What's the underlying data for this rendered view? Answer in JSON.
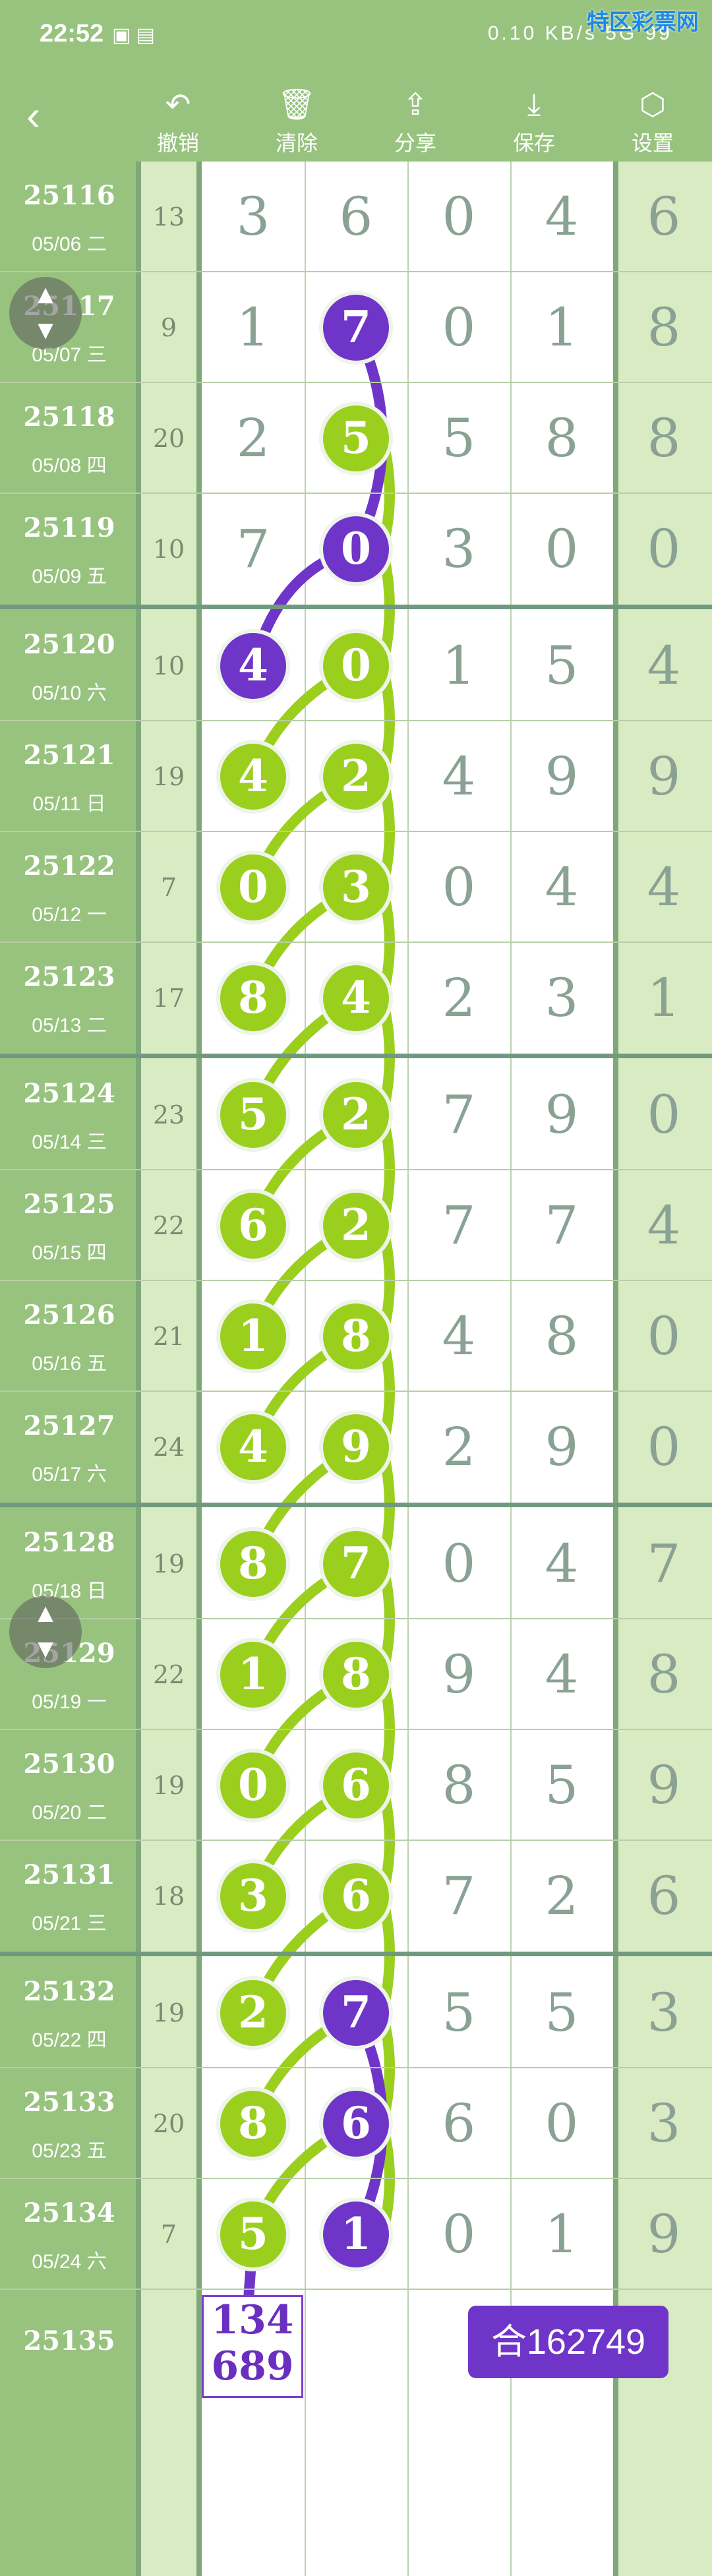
{
  "statusbar": {
    "time": "22:52",
    "right": "0.10 KB/s  5G  99",
    "watermark": "特区彩票网"
  },
  "toolbar": {
    "back_icon": "back-arrow-icon",
    "buttons": [
      {
        "label": "撤销",
        "icon": "undo-icon"
      },
      {
        "label": "清除",
        "icon": "trash-icon"
      },
      {
        "label": "分享",
        "icon": "share-icon"
      },
      {
        "label": "保存",
        "icon": "download-icon"
      },
      {
        "label": "设置",
        "icon": "gear-icon"
      }
    ]
  },
  "colors": {
    "green_ball": "#9bcf1e",
    "purple_ball": "#6f35c8",
    "header": "#97c37f"
  },
  "rows": [
    {
      "issue": "25116",
      "date": "05/06 二",
      "sum": "13",
      "digits": [
        "3",
        "6",
        "0",
        "4"
      ],
      "right": "6",
      "ball1": null,
      "ball2": null
    },
    {
      "issue": "25117",
      "date": "05/07 三",
      "sum": "9",
      "digits": [
        "1",
        "7",
        "0",
        "1"
      ],
      "right": "8",
      "ball1": null,
      "ball2": "p"
    },
    {
      "issue": "25118",
      "date": "05/08 四",
      "sum": "20",
      "digits": [
        "2",
        "5",
        "5",
        "8"
      ],
      "right": "8",
      "ball1": null,
      "ball2": "g"
    },
    {
      "issue": "25119",
      "date": "05/09 五",
      "sum": "10",
      "digits": [
        "7",
        "0",
        "3",
        "0"
      ],
      "right": "0",
      "ball1": null,
      "ball2": "p"
    },
    {
      "issue": "25120",
      "date": "05/10 六",
      "sum": "10",
      "digits": [
        "4",
        "0",
        "1",
        "5"
      ],
      "right": "4",
      "ball1": "p",
      "ball2": "g"
    },
    {
      "issue": "25121",
      "date": "05/11 日",
      "sum": "19",
      "digits": [
        "4",
        "2",
        "4",
        "9"
      ],
      "right": "9",
      "ball1": "g",
      "ball2": "g"
    },
    {
      "issue": "25122",
      "date": "05/12 一",
      "sum": "7",
      "digits": [
        "0",
        "3",
        "0",
        "4"
      ],
      "right": "4",
      "ball1": "g",
      "ball2": "g"
    },
    {
      "issue": "25123",
      "date": "05/13 二",
      "sum": "17",
      "digits": [
        "8",
        "4",
        "2",
        "3"
      ],
      "right": "1",
      "ball1": "g",
      "ball2": "g"
    },
    {
      "issue": "25124",
      "date": "05/14 三",
      "sum": "23",
      "digits": [
        "5",
        "2",
        "7",
        "9"
      ],
      "right": "0",
      "ball1": "g",
      "ball2": "g"
    },
    {
      "issue": "25125",
      "date": "05/15 四",
      "sum": "22",
      "digits": [
        "6",
        "2",
        "7",
        "7"
      ],
      "right": "4",
      "ball1": "g",
      "ball2": "g"
    },
    {
      "issue": "25126",
      "date": "05/16 五",
      "sum": "21",
      "digits": [
        "1",
        "8",
        "4",
        "8"
      ],
      "right": "0",
      "ball1": "g",
      "ball2": "g"
    },
    {
      "issue": "25127",
      "date": "05/17 六",
      "sum": "24",
      "digits": [
        "4",
        "9",
        "2",
        "9"
      ],
      "right": "0",
      "ball1": "g",
      "ball2": "g"
    },
    {
      "issue": "25128",
      "date": "05/18 日",
      "sum": "19",
      "digits": [
        "8",
        "7",
        "0",
        "4"
      ],
      "right": "7",
      "ball1": "g",
      "ball2": "g"
    },
    {
      "issue": "25129",
      "date": "05/19 一",
      "sum": "22",
      "digits": [
        "1",
        "8",
        "9",
        "4"
      ],
      "right": "8",
      "ball1": "g",
      "ball2": "g"
    },
    {
      "issue": "25130",
      "date": "05/20 二",
      "sum": "19",
      "digits": [
        "0",
        "6",
        "8",
        "5"
      ],
      "right": "9",
      "ball1": "g",
      "ball2": "g"
    },
    {
      "issue": "25131",
      "date": "05/21 三",
      "sum": "18",
      "digits": [
        "3",
        "6",
        "7",
        "2"
      ],
      "right": "6",
      "ball1": "g",
      "ball2": "g"
    },
    {
      "issue": "25132",
      "date": "05/22 四",
      "sum": "19",
      "digits": [
        "2",
        "7",
        "5",
        "5"
      ],
      "right": "3",
      "ball1": "g",
      "ball2": "p"
    },
    {
      "issue": "25133",
      "date": "05/23 五",
      "sum": "20",
      "digits": [
        "8",
        "6",
        "6",
        "0"
      ],
      "right": "3",
      "ball1": "g",
      "ball2": "p"
    },
    {
      "issue": "25134",
      "date": "05/24 六",
      "sum": "7",
      "digits": [
        "5",
        "1",
        "0",
        "1"
      ],
      "right": "9",
      "ball1": "g",
      "ball2": "p"
    }
  ],
  "prediction": {
    "issue": "25135",
    "box_line1": "134",
    "box_line2": "689",
    "sum_badge": "合162749"
  },
  "float_button_icon": "up-down-arrows-icon"
}
